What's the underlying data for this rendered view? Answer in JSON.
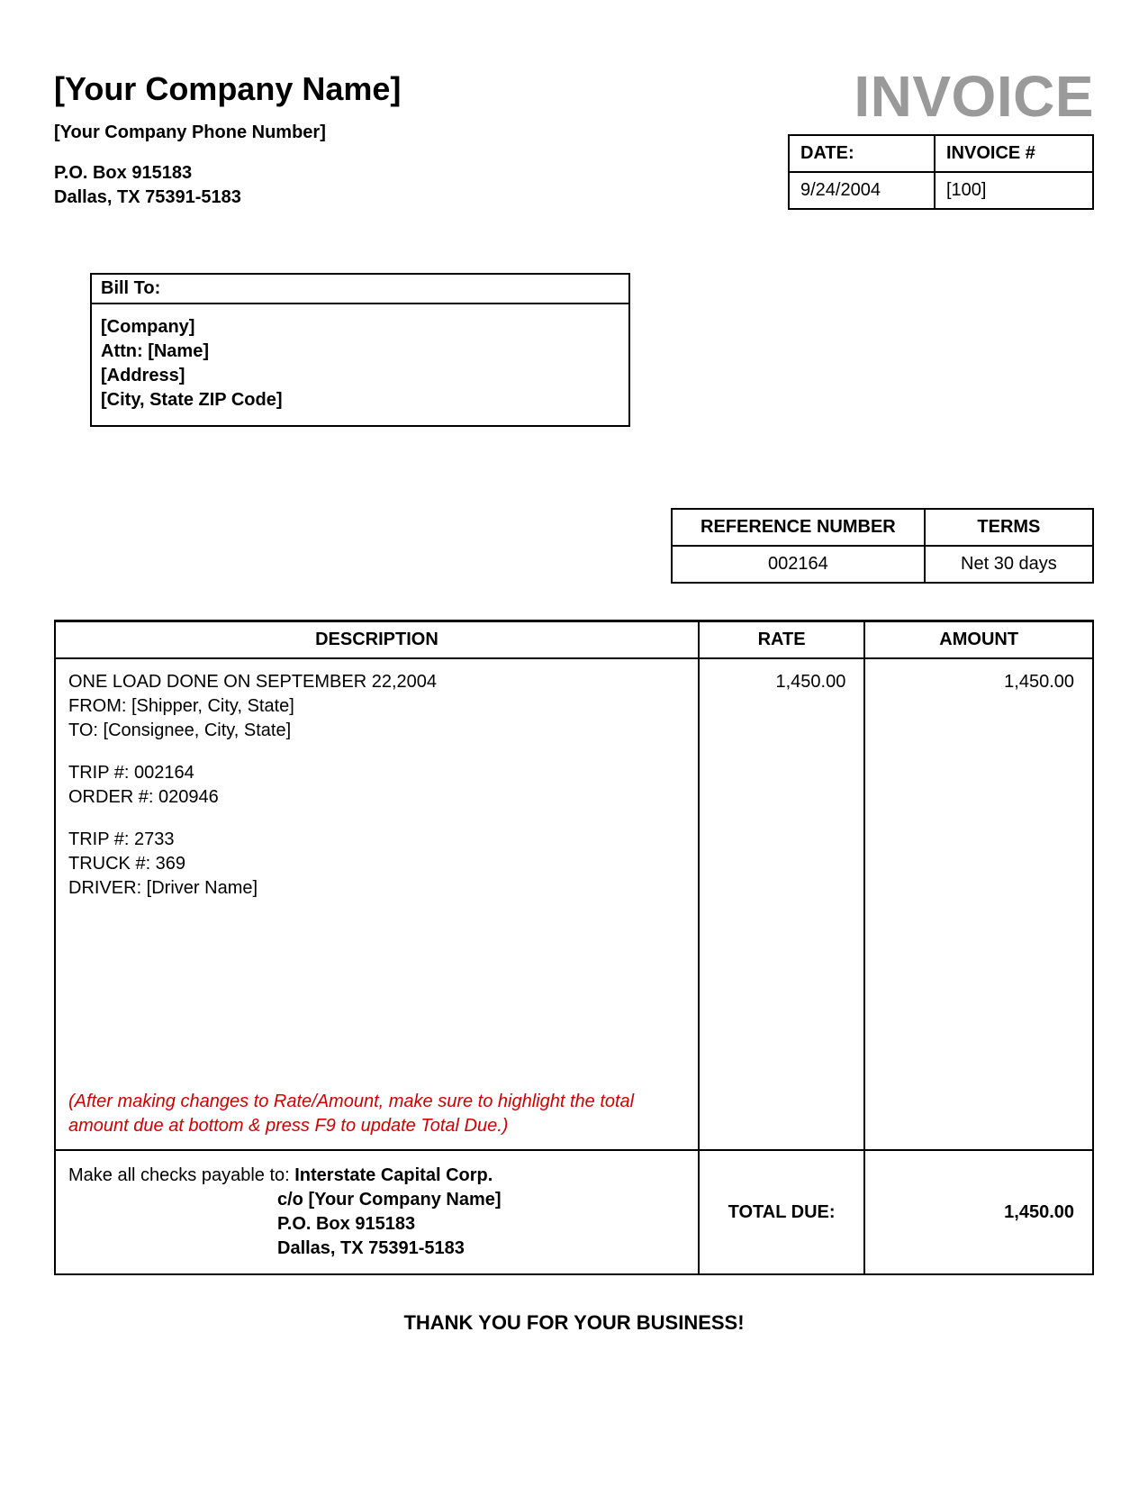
{
  "company": {
    "name": "[Your Company Name]",
    "phone": "[Your Company Phone Number]",
    "addr1": "P.O. Box 915183",
    "addr2": "Dallas, TX 75391-5183"
  },
  "invoice": {
    "title": "INVOICE",
    "date_label": "DATE:",
    "date_value": "9/24/2004",
    "number_label": "INVOICE #",
    "number_value": "[100]"
  },
  "bill_to": {
    "header": "Bill To:",
    "company": "[Company]",
    "attn": "Attn: [Name]",
    "address": "[Address]",
    "citystatezip": "[City, State  ZIP Code]"
  },
  "ref_terms": {
    "ref_label": "REFERENCE NUMBER",
    "ref_value": "002164",
    "terms_label": "TERMS",
    "terms_value": "Net 30 days"
  },
  "columns": {
    "description": "DESCRIPTION",
    "rate": "RATE",
    "amount": "AMOUNT"
  },
  "line": {
    "rate": "1,450.00",
    "amount": "1,450.00",
    "desc_line1": "ONE LOAD DONE ON SEPTEMBER 22,2004",
    "desc_from": "FROM: [Shipper, City, State]",
    "desc_to": "TO: [Consignee, City, State]",
    "trip1": "TRIP #: 002164",
    "order": "ORDER #: 020946",
    "trip2": "TRIP #: 2733",
    "truck": "TRUCK #: 369",
    "driver": "DRIVER: [Driver Name]"
  },
  "note": "(After making changes to Rate/Amount, make sure to highlight the total amount due at bottom & press F9 to update Total Due.)",
  "payable": {
    "intro": "Make all checks payable to: ",
    "corp": "Interstate Capital Corp.",
    "co": "c/o [Your Company Name]",
    "addr1": "P.O. Box 915183",
    "addr2": "Dallas, TX 75391-5183"
  },
  "totals": {
    "label": "TOTAL DUE:",
    "amount": "1,450.00"
  },
  "thank_you": "THANK YOU FOR YOUR BUSINESS!"
}
